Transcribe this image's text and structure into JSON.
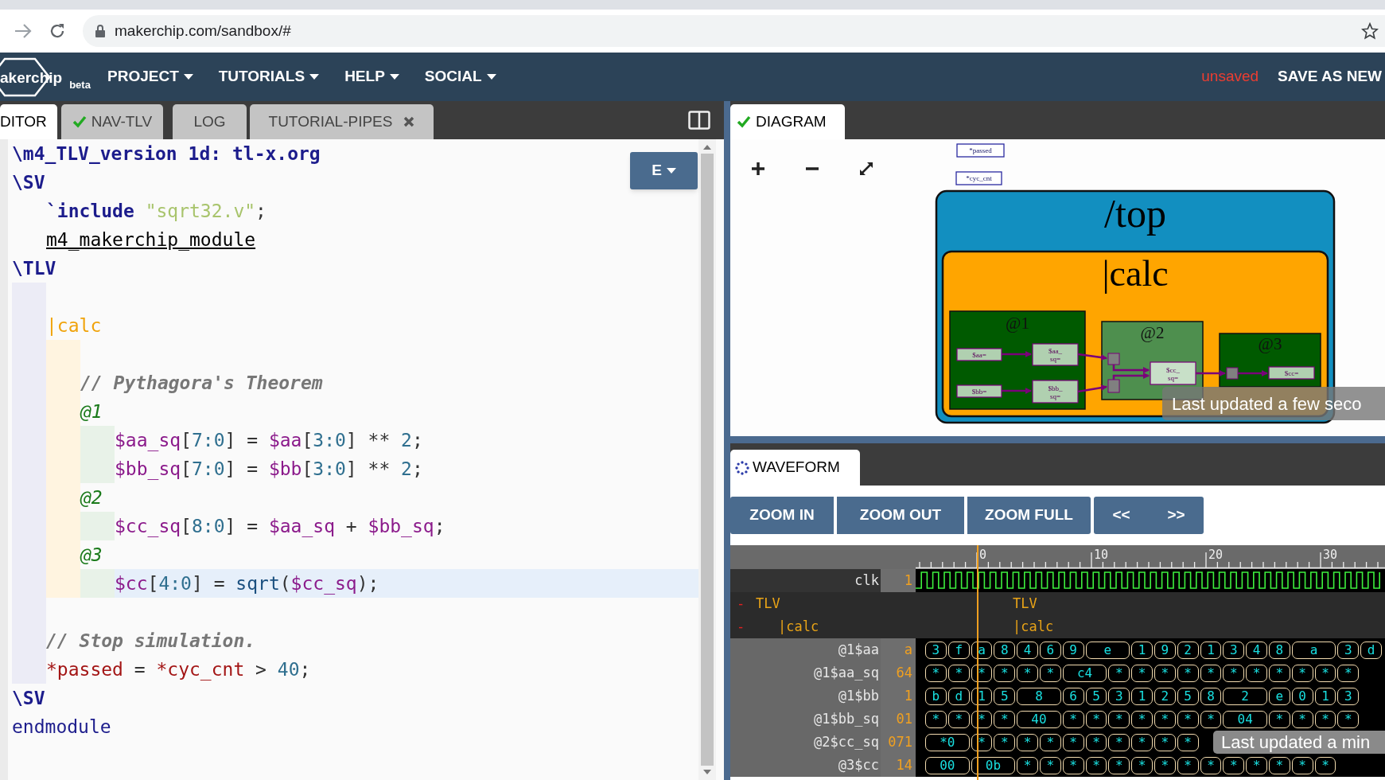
{
  "browser": {
    "url": "makerchip.com/sandbox/#"
  },
  "nav": {
    "logo": "akerchip",
    "badge": "beta",
    "menus": [
      "PROJECT",
      "TUTORIALS",
      "HELP",
      "SOCIAL"
    ],
    "save_state": "unsaved",
    "save_button": "SAVE AS NEW"
  },
  "editor": {
    "tabs": [
      {
        "label": "DITOR",
        "selected": true,
        "ok": false,
        "closable": false
      },
      {
        "label": "NAV-TLV",
        "selected": false,
        "ok": true,
        "closable": false
      },
      {
        "label": "LOG",
        "selected": false,
        "ok": false,
        "closable": false
      },
      {
        "label": "TUTORIAL-PIPES",
        "selected": false,
        "ok": false,
        "closable": true
      }
    ],
    "mode_button": "E",
    "lines": [
      {
        "kind": "code",
        "active": false,
        "tokens": [
          {
            "kind": "directive",
            "text": "\\m4_TLV_version 1d: tl-x.org"
          }
        ]
      },
      {
        "kind": "sv_block",
        "active": false,
        "tokens": [
          {
            "kind": "directive",
            "text": "\\SV"
          }
        ],
        "children": [
          {
            "kind": "code",
            "active": false,
            "tokens": [
              {
                "kind": "directive",
                "text": "`include"
              },
              {
                "kind": "string",
                "text": " \"sqrt32.v\""
              },
              {
                "kind": "plain",
                "text": ";"
              }
            ]
          },
          {
            "kind": "code",
            "active": false,
            "tokens": [
              {
                "kind": "macro",
                "text": "m4_makerchip_module"
              }
            ]
          }
        ]
      },
      {
        "kind": "tlv_block",
        "active": false,
        "tokens": [
          {
            "kind": "directive",
            "text": "\\TLV"
          }
        ],
        "children": [
          {
            "kind": "blank"
          },
          {
            "kind": "pipe_block",
            "active": false,
            "tokens": [
              {
                "kind": "pipe",
                "text": "|calc"
              }
            ],
            "children": [
              {
                "kind": "blank"
              },
              {
                "kind": "code",
                "active": false,
                "tokens": [
                  {
                    "kind": "comment",
                    "text": "// Pythagora's Theorem"
                  }
                ]
              },
              {
                "kind": "stage_block",
                "active": false,
                "tokens": [
                  {
                    "kind": "stage",
                    "text": "@1"
                  }
                ],
                "children": [
                  {
                    "kind": "code",
                    "active": false,
                    "tokens": [
                      {
                        "kind": "sig",
                        "text": "$aa_sq"
                      },
                      {
                        "kind": "plain",
                        "text": "["
                      },
                      {
                        "kind": "num",
                        "text": "7:0"
                      },
                      {
                        "kind": "plain",
                        "text": "] = "
                      },
                      {
                        "kind": "sig",
                        "text": "$aa"
                      },
                      {
                        "kind": "plain",
                        "text": "["
                      },
                      {
                        "kind": "num",
                        "text": "3:0"
                      },
                      {
                        "kind": "plain",
                        "text": "] ** "
                      },
                      {
                        "kind": "num",
                        "text": "2"
                      },
                      {
                        "kind": "plain",
                        "text": ";"
                      }
                    ]
                  },
                  {
                    "kind": "code",
                    "active": false,
                    "tokens": [
                      {
                        "kind": "sig",
                        "text": "$bb_sq"
                      },
                      {
                        "kind": "plain",
                        "text": "["
                      },
                      {
                        "kind": "num",
                        "text": "7:0"
                      },
                      {
                        "kind": "plain",
                        "text": "] = "
                      },
                      {
                        "kind": "sig",
                        "text": "$bb"
                      },
                      {
                        "kind": "plain",
                        "text": "["
                      },
                      {
                        "kind": "num",
                        "text": "3:0"
                      },
                      {
                        "kind": "plain",
                        "text": "] ** "
                      },
                      {
                        "kind": "num",
                        "text": "2"
                      },
                      {
                        "kind": "plain",
                        "text": ";"
                      }
                    ]
                  }
                ]
              },
              {
                "kind": "stage_block",
                "active": false,
                "tokens": [
                  {
                    "kind": "stage",
                    "text": "@2"
                  }
                ],
                "children": [
                  {
                    "kind": "code",
                    "active": false,
                    "tokens": [
                      {
                        "kind": "sig",
                        "text": "$cc_sq"
                      },
                      {
                        "kind": "plain",
                        "text": "["
                      },
                      {
                        "kind": "num",
                        "text": "8:0"
                      },
                      {
                        "kind": "plain",
                        "text": "] = "
                      },
                      {
                        "kind": "sig",
                        "text": "$aa_sq"
                      },
                      {
                        "kind": "plain",
                        "text": " + "
                      },
                      {
                        "kind": "sig",
                        "text": "$bb_sq"
                      },
                      {
                        "kind": "plain",
                        "text": ";"
                      }
                    ]
                  }
                ]
              },
              {
                "kind": "stage_block",
                "active": false,
                "tokens": [
                  {
                    "kind": "stage",
                    "text": "@3"
                  }
                ],
                "children": [
                  {
                    "kind": "code",
                    "active": true,
                    "tokens": [
                      {
                        "kind": "sig",
                        "text": "$cc"
                      },
                      {
                        "kind": "plain",
                        "text": "["
                      },
                      {
                        "kind": "num",
                        "text": "4:0"
                      },
                      {
                        "kind": "plain",
                        "text": "] = "
                      },
                      {
                        "kind": "func",
                        "text": "sqrt"
                      },
                      {
                        "kind": "plain",
                        "text": "("
                      },
                      {
                        "kind": "sig",
                        "text": "$cc_sq"
                      },
                      {
                        "kind": "plain",
                        "text": ");"
                      }
                    ]
                  }
                ]
              }
            ]
          },
          {
            "kind": "blank"
          },
          {
            "kind": "code",
            "active": false,
            "tokens": [
              {
                "kind": "comment",
                "text": "// Stop simulation."
              }
            ]
          },
          {
            "kind": "code",
            "active": false,
            "tokens": [
              {
                "kind": "sysvar",
                "text": "*passed"
              },
              {
                "kind": "plain",
                "text": " = "
              },
              {
                "kind": "sysvar",
                "text": "*cyc_cnt"
              },
              {
                "kind": "plain",
                "text": " > "
              },
              {
                "kind": "num",
                "text": "40"
              },
              {
                "kind": "plain",
                "text": ";"
              }
            ]
          }
        ]
      },
      {
        "kind": "code",
        "active": false,
        "tokens": [
          {
            "kind": "directive",
            "text": "\\SV"
          }
        ]
      },
      {
        "kind": "code",
        "active": false,
        "tokens": [
          {
            "kind": "keyword",
            "text": "endmodule"
          }
        ]
      }
    ]
  },
  "diagram": {
    "tab": {
      "label": "DIAGRAM",
      "ok": true
    },
    "globals": [
      "*passed",
      "*cyc_cnt"
    ],
    "scope": "/top",
    "pipeline": "|calc",
    "stages": [
      {
        "label": "@1",
        "color": "#005a00",
        "nodes": [
          {
            "lines": [
              "$aa="
            ]
          },
          {
            "lines": [
              "$aa_",
              "sq="
            ]
          },
          {
            "lines": [
              "$bb="
            ]
          },
          {
            "lines": [
              "$bb_",
              "sq="
            ]
          }
        ]
      },
      {
        "label": "@2",
        "color": "#4e8f4e",
        "nodes": [
          {
            "lines": [
              "$cc_",
              "sq="
            ]
          }
        ]
      },
      {
        "label": "@3",
        "color": "#005a00",
        "nodes": [
          {
            "lines": [
              "$cc="
            ]
          }
        ]
      }
    ],
    "toast": "Last updated a few seco"
  },
  "waveform": {
    "tab": {
      "label": "WAVEFORM",
      "loading": true
    },
    "zoom_buttons": [
      "ZOOM IN",
      "ZOOM OUT",
      "ZOOM FULL"
    ],
    "step_buttons": [
      "<<",
      ">>"
    ],
    "ruler": [
      "0",
      "10",
      "20",
      "30"
    ],
    "signals": [
      {
        "kind": "clock",
        "name": "clk",
        "value": "1"
      },
      {
        "kind": "scope",
        "toggle": "-",
        "name": "TLV",
        "wave_label": "TLV",
        "children": [
          {
            "kind": "scope",
            "toggle": "-",
            "name": "|calc",
            "wave_label": "|calc",
            "children": [
              {
                "kind": "bus",
                "name": "@1$aa",
                "value": "a",
                "segments": [
                  {
                    "text": "3",
                    "wide": false
                  },
                  {
                    "text": "f",
                    "wide": false
                  },
                  {
                    "text": "a",
                    "wide": false
                  },
                  {
                    "text": "8",
                    "wide": false
                  },
                  {
                    "text": "4",
                    "wide": false
                  },
                  {
                    "text": "6",
                    "wide": false
                  },
                  {
                    "text": "9",
                    "wide": false
                  },
                  {
                    "text": "e",
                    "wide": true
                  },
                  {
                    "text": "1",
                    "wide": false
                  },
                  {
                    "text": "9",
                    "wide": false
                  },
                  {
                    "text": "2",
                    "wide": false
                  },
                  {
                    "text": "1",
                    "wide": false
                  },
                  {
                    "text": "3",
                    "wide": false
                  },
                  {
                    "text": "4",
                    "wide": false
                  },
                  {
                    "text": "8",
                    "wide": false
                  },
                  {
                    "text": "a",
                    "wide": true
                  },
                  {
                    "text": "3",
                    "wide": false
                  },
                  {
                    "text": "d",
                    "wide": false
                  }
                ]
              },
              {
                "kind": "bus",
                "name": "@1$aa_sq",
                "value": "64",
                "segments": [
                  {
                    "text": "*",
                    "wide": false
                  },
                  {
                    "text": "*",
                    "wide": false
                  },
                  {
                    "text": "*",
                    "wide": false
                  },
                  {
                    "text": "*",
                    "wide": false
                  },
                  {
                    "text": "*",
                    "wide": false
                  },
                  {
                    "text": "*",
                    "wide": false
                  },
                  {
                    "text": "c4",
                    "wide": true
                  },
                  {
                    "text": "*",
                    "wide": false
                  },
                  {
                    "text": "*",
                    "wide": false
                  },
                  {
                    "text": "*",
                    "wide": false
                  },
                  {
                    "text": "*",
                    "wide": false
                  },
                  {
                    "text": "*",
                    "wide": false
                  },
                  {
                    "text": "*",
                    "wide": false
                  },
                  {
                    "text": "*",
                    "wide": false
                  },
                  {
                    "text": "*",
                    "wide": false
                  },
                  {
                    "text": "*",
                    "wide": false
                  },
                  {
                    "text": "*",
                    "wide": false
                  },
                  {
                    "text": "*",
                    "wide": false
                  }
                ]
              },
              {
                "kind": "bus",
                "name": "@1$bb",
                "value": "1",
                "segments": [
                  {
                    "text": "b",
                    "wide": false
                  },
                  {
                    "text": "d",
                    "wide": false
                  },
                  {
                    "text": "1",
                    "wide": false
                  },
                  {
                    "text": "5",
                    "wide": false
                  },
                  {
                    "text": "8",
                    "wide": true
                  },
                  {
                    "text": "6",
                    "wide": false
                  },
                  {
                    "text": "5",
                    "wide": false
                  },
                  {
                    "text": "3",
                    "wide": false
                  },
                  {
                    "text": "1",
                    "wide": false
                  },
                  {
                    "text": "2",
                    "wide": false
                  },
                  {
                    "text": "5",
                    "wide": false
                  },
                  {
                    "text": "8",
                    "wide": false
                  },
                  {
                    "text": "2",
                    "wide": true
                  },
                  {
                    "text": "e",
                    "wide": false
                  },
                  {
                    "text": "0",
                    "wide": false
                  },
                  {
                    "text": "1",
                    "wide": false
                  },
                  {
                    "text": "3",
                    "wide": false
                  }
                ]
              },
              {
                "kind": "bus",
                "name": "@1$bb_sq",
                "value": "01",
                "segments": [
                  {
                    "text": "*",
                    "wide": false
                  },
                  {
                    "text": "*",
                    "wide": false
                  },
                  {
                    "text": "*",
                    "wide": false
                  },
                  {
                    "text": "*",
                    "wide": false
                  },
                  {
                    "text": "40",
                    "wide": true
                  },
                  {
                    "text": "*",
                    "wide": false
                  },
                  {
                    "text": "*",
                    "wide": false
                  },
                  {
                    "text": "*",
                    "wide": false
                  },
                  {
                    "text": "*",
                    "wide": false
                  },
                  {
                    "text": "*",
                    "wide": false
                  },
                  {
                    "text": "*",
                    "wide": false
                  },
                  {
                    "text": "*",
                    "wide": false
                  },
                  {
                    "text": "04",
                    "wide": true
                  },
                  {
                    "text": "*",
                    "wide": false
                  },
                  {
                    "text": "*",
                    "wide": false
                  },
                  {
                    "text": "*",
                    "wide": false
                  },
                  {
                    "text": "*",
                    "wide": false
                  }
                ]
              },
              {
                "kind": "bus",
                "name": "@2$cc_sq",
                "value": "071",
                "segments": [
                  {
                    "text": "*0",
                    "wide": true
                  },
                  {
                    "text": "*",
                    "wide": false
                  },
                  {
                    "text": "*",
                    "wide": false
                  },
                  {
                    "text": "*",
                    "wide": false
                  },
                  {
                    "text": "*",
                    "wide": false
                  },
                  {
                    "text": "*",
                    "wide": false
                  },
                  {
                    "text": "*",
                    "wide": false
                  },
                  {
                    "text": "*",
                    "wide": false
                  },
                  {
                    "text": "*",
                    "wide": false
                  },
                  {
                    "text": "*",
                    "wide": false
                  },
                  {
                    "text": "*",
                    "wide": false
                  }
                ]
              },
              {
                "kind": "bus",
                "name": "@3$cc",
                "value": "14",
                "segments": [
                  {
                    "text": "00",
                    "wide": true
                  },
                  {
                    "text": "0b",
                    "wide": true
                  },
                  {
                    "text": "*",
                    "wide": false
                  },
                  {
                    "text": "*",
                    "wide": false
                  },
                  {
                    "text": "*",
                    "wide": false
                  },
                  {
                    "text": "*",
                    "wide": false
                  },
                  {
                    "text": "*",
                    "wide": false
                  },
                  {
                    "text": "*",
                    "wide": false
                  },
                  {
                    "text": "*",
                    "wide": false
                  },
                  {
                    "text": "*",
                    "wide": false
                  },
                  {
                    "text": "*",
                    "wide": false
                  },
                  {
                    "text": "*",
                    "wide": false
                  },
                  {
                    "text": "*",
                    "wide": false
                  },
                  {
                    "text": "*",
                    "wide": false
                  },
                  {
                    "text": "*",
                    "wide": false
                  },
                  {
                    "text": "*",
                    "wide": false
                  }
                ]
              }
            ]
          }
        ]
      }
    ],
    "toast": "Last updated a min"
  }
}
